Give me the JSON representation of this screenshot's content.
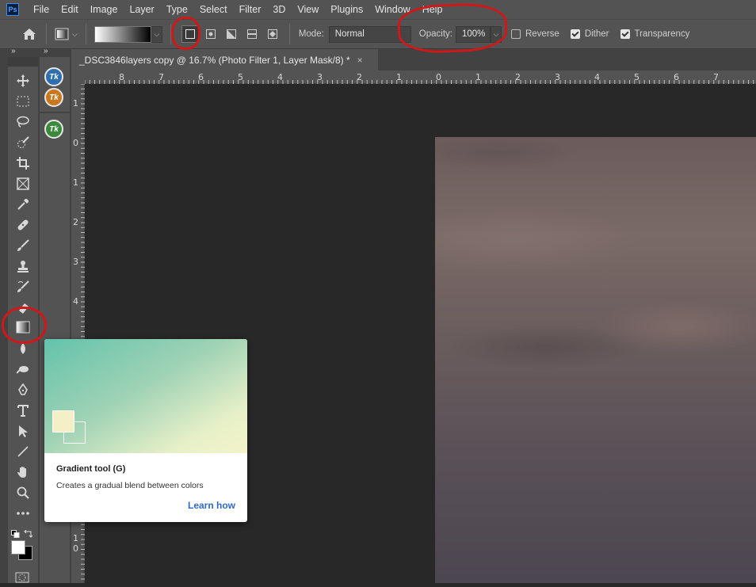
{
  "app": {
    "logo_text": "Ps"
  },
  "menu": [
    "File",
    "Edit",
    "Image",
    "Layer",
    "Type",
    "Select",
    "Filter",
    "3D",
    "View",
    "Plugins",
    "Window",
    "Help"
  ],
  "options": {
    "mode_label": "Mode:",
    "mode_value": "Normal",
    "opacity_label": "Opacity:",
    "opacity_value": "100%",
    "reverse_label": "Reverse",
    "reverse_checked": false,
    "dither_label": "Dither",
    "dither_checked": true,
    "transparency_label": "Transparency",
    "transparency_checked": true
  },
  "document": {
    "tab_title": "_DSC3846layers copy @ 16.7% (Photo Filter 1, Layer Mask/8) *",
    "close_glyph": "×"
  },
  "rulers": {
    "horizontal": [
      "8",
      "7",
      "6",
      "5",
      "4",
      "3",
      "2",
      "1",
      "0",
      "1",
      "2",
      "3",
      "4",
      "5",
      "6",
      "7"
    ],
    "vertical": [
      "1",
      "0",
      "1",
      "2",
      "3",
      "4",
      "1",
      "0"
    ]
  },
  "panels": {
    "collapse_glyph": "»"
  },
  "tools": [
    "move-tool",
    "marquee-tool",
    "lasso-tool",
    "quick-selection-tool",
    "crop-tool",
    "frame-tool",
    "eyedropper-tool",
    "healing-brush-tool",
    "brush-tool",
    "clone-stamp-tool",
    "history-brush-tool",
    "eraser-tool",
    "gradient-tool",
    "blur-tool",
    "dodge-tool",
    "pen-tool",
    "type-tool",
    "path-selection-tool",
    "line-tool",
    "hand-tool",
    "zoom-tool",
    "more-tools"
  ],
  "dock_plugins": [
    {
      "label": "Tk",
      "color": "#2f6fb0"
    },
    {
      "label": "Tk",
      "color": "#c9781f"
    },
    {
      "label": "Tk",
      "color": "#3b8a3b"
    }
  ],
  "tooltip": {
    "title": "Gradient tool (G)",
    "description": "Creates a gradual blend between colors",
    "link": "Learn how"
  },
  "colors": {
    "annotation": "#d01818",
    "foreground": "#ffffff",
    "background": "#000000",
    "link": "#2d6bc8"
  }
}
